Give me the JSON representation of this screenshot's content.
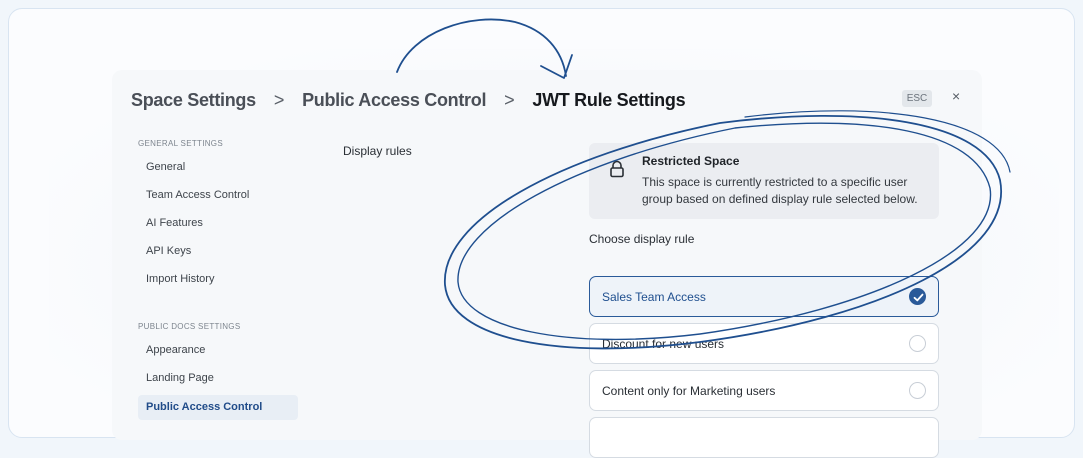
{
  "header": {
    "breadcrumb": [
      "Space Settings",
      "Public Access Control",
      "JWT Rule Settings"
    ],
    "separator": ">",
    "esc_label": "ESC",
    "close_label": "×"
  },
  "sidebar": {
    "general_heading": "GENERAL SETTINGS",
    "general_items": [
      "General",
      "Team Access Control",
      "AI Features",
      "API Keys",
      "Import History"
    ],
    "public_heading": "PUBLIC DOCS SETTINGS",
    "public_items": [
      "Appearance",
      "Landing Page",
      "Public Access Control"
    ],
    "active_item": "Public Access Control"
  },
  "main": {
    "section_label": "Display rules",
    "notice": {
      "title": "Restricted Space",
      "body": "This space is currently restricted to a specific user group based on defined display rule selected below.",
      "icon": "lock-icon"
    },
    "choose_label": "Choose display rule",
    "options": [
      {
        "label": "Sales Team Access",
        "selected": true
      },
      {
        "label": "Discount for new users",
        "selected": false
      },
      {
        "label": "Content only for Marketing users",
        "selected": false
      }
    ]
  },
  "colors": {
    "accent": "#2a5a99",
    "doodle": "#1f4f8f"
  }
}
